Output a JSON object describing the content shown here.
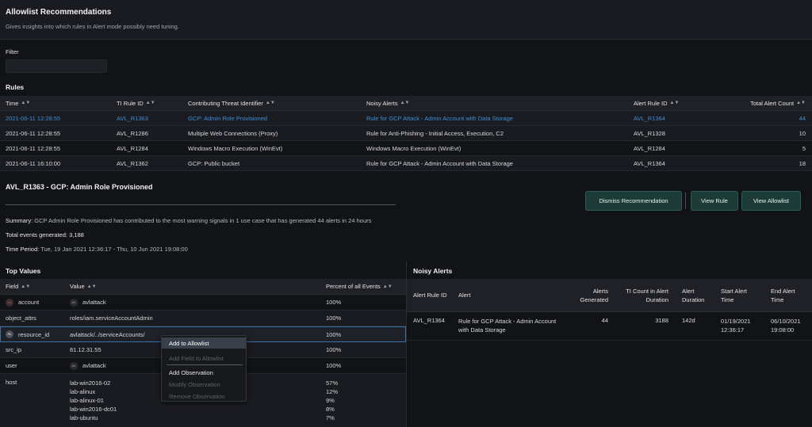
{
  "header": {
    "title": "Allowlist Recommendations",
    "subtitle": "Gives insights into which rules in Alert mode possibly need tuning."
  },
  "filter": {
    "label": "Filter",
    "placeholder": ""
  },
  "rules": {
    "section_title": "Rules",
    "columns": [
      "Time",
      "TI Rule ID",
      "Contributing Threat Identifier",
      "Noisy Alerts",
      "Alert Rule ID",
      "Total Alert Count"
    ],
    "rows": [
      [
        "2021-06-11 12:28:55",
        "AVL_R1363",
        "GCP: Admin Role Provisioned",
        "Rule for GCP Attack - Admin Account with Data Storage",
        "AVL_R1364",
        "44"
      ],
      [
        "2021-06-11 12:28:55",
        "AVL_R1286",
        "Multiple Web Connections (Proxy)",
        "Rule for Anti-Phishing - Initial Access, Execution, C2",
        "AVL_R1328",
        "10"
      ],
      [
        "2021-06-11 12:28:55",
        "AVL_R1284",
        "Windows Macro Execution (WinEvt)",
        "Windows Macro Execution (WinEvt)",
        "AVL_R1284",
        "5"
      ],
      [
        "2021-06-11 16:10:00",
        "AVL_R1362",
        "GCP: Public bucket",
        "Rule for GCP Attack - Admin Account with Data Storage",
        "AVL_R1364",
        "18"
      ]
    ]
  },
  "detail": {
    "title": "AVL_R1363 - GCP: Admin Role Provisioned",
    "summary_label": "Summary:",
    "summary_text": "GCP Admin Role Provisioned has contributed to the most warning signals in 1 use case that has generated 44 alerts in 24 hours",
    "total_events_label": "Total events generated:",
    "total_events_value": "3,188",
    "time_period_label": "Time Period:",
    "time_period_value": "Tue, 19 Jan 2021 12:36:17 - Thu, 10 Jun 2021 19:08:00",
    "buttons": {
      "dismiss": "Dismiss Recommendation",
      "view_rule": "View Rule",
      "view_allowlist": "View Allowlist"
    }
  },
  "top_values": {
    "section_title": "Top Values",
    "columns": [
      "Field",
      "Value",
      "Percent of all Events"
    ],
    "rows": [
      {
        "field": "account",
        "field_avatar": "AC",
        "value": "avlattack",
        "value_avatar": "AV",
        "percent": "100%"
      },
      {
        "field": "object_attrs",
        "value": "roles/iam.serviceAccountAdmin",
        "percent": "100%"
      },
      {
        "field": "resource_id",
        "field_avatar": "AL",
        "value": "avlattack/../serviceAccounts/",
        "percent": "100%"
      },
      {
        "field": "src_ip",
        "value": "81.12.31.55",
        "percent": "100%"
      },
      {
        "field": "user",
        "value": "avlattack",
        "value_avatar": "AV",
        "percent": "100%"
      }
    ],
    "host": {
      "field": "host",
      "values": [
        "lab-win2016-02",
        "lab-alinux",
        "lab-alinux-01",
        "lab-win2016-dc01",
        "lab-ubuntu"
      ],
      "percents": [
        "57%",
        "12%",
        "9%",
        "8%",
        "7%"
      ]
    }
  },
  "context_menu": {
    "items": [
      "Add to Allowlist",
      "Add Field to Allowlist",
      "Add Observation",
      "Modify Observation",
      "Remove Observation"
    ]
  },
  "noisy_alerts": {
    "section_title": "Noisy Alerts",
    "columns": [
      "Alert Rule ID",
      "Alert",
      "Alerts Generated",
      "TI Count in Alert Duration",
      "Alert Duration",
      "Start Alert Time",
      "End Alert Time"
    ],
    "row": {
      "rule_id": "AVL_R1364",
      "alert": "Rule for GCP Attack - Admin Account with Data Storage",
      "alerts_generated": "44",
      "ti_count": "3188",
      "duration": "142d",
      "start": "01/19/2021 12:36:17",
      "end": "06/10/2021 19:08:00"
    }
  },
  "colors": {
    "background": "#121317",
    "accent_blue": "#3d8ed6",
    "button_green": "#1d3b36"
  }
}
